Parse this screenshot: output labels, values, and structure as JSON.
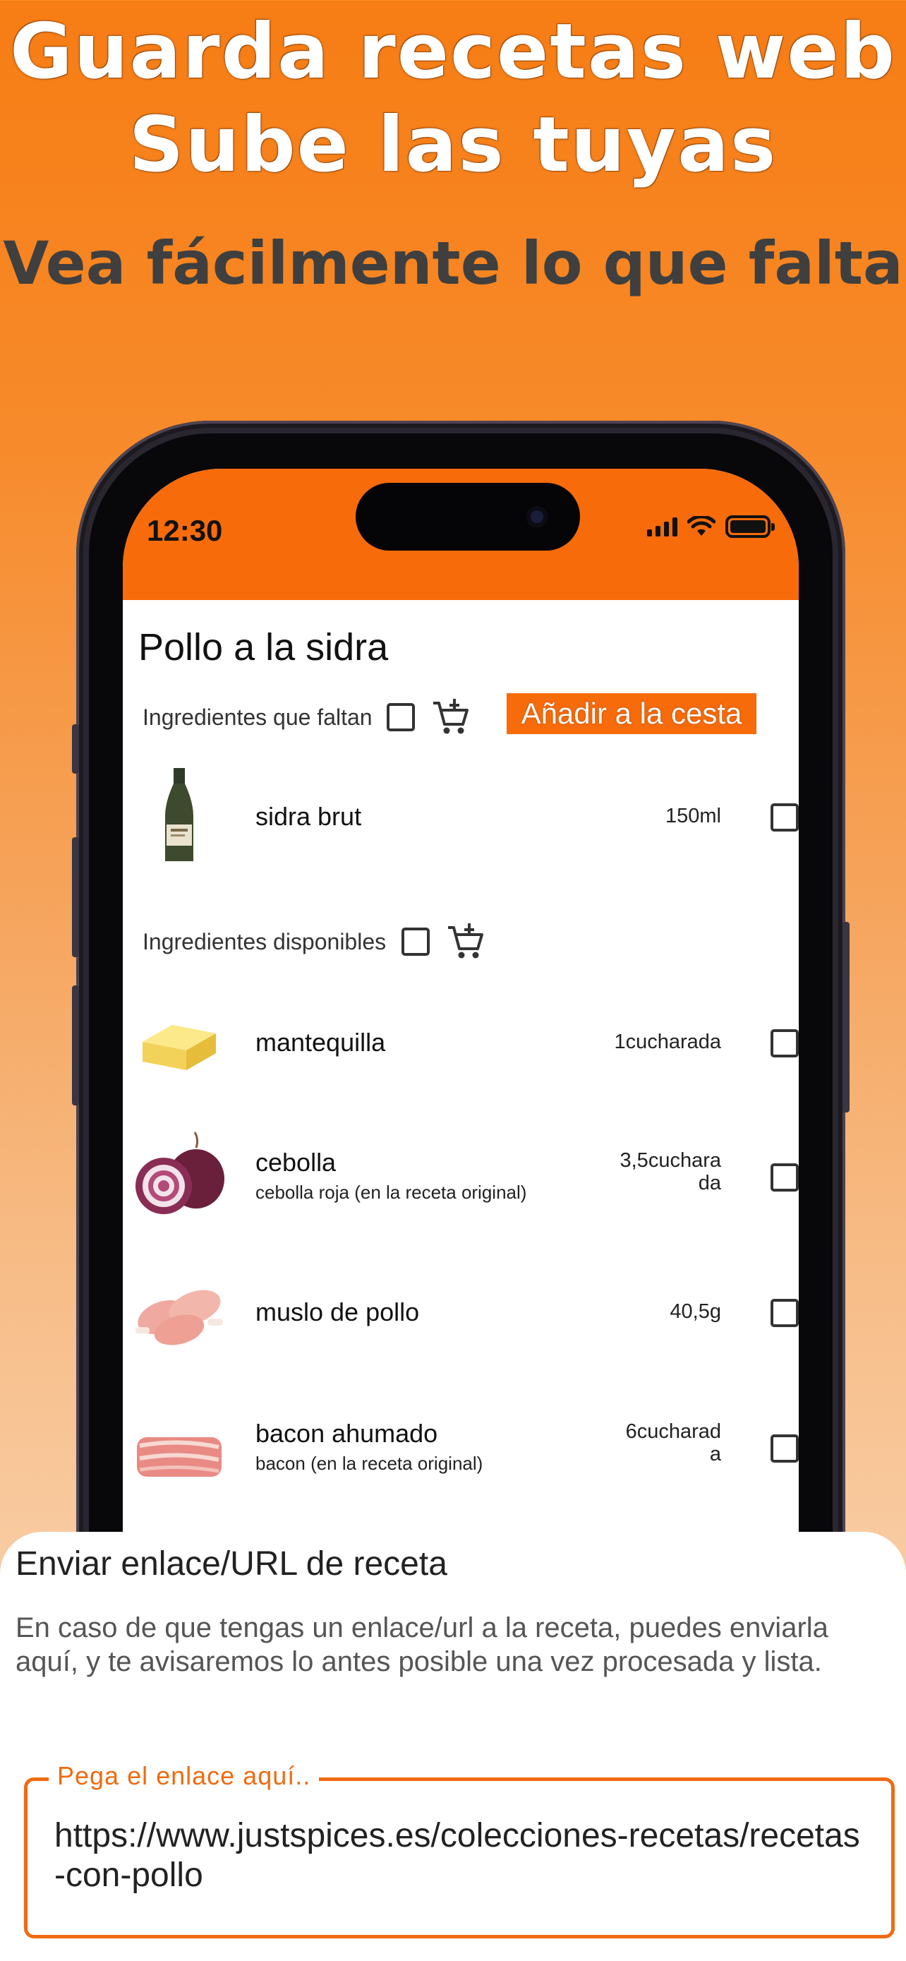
{
  "promo": {
    "line1": "Guarda recetas web",
    "line2": "Sube las tuyas",
    "line3": "Vea fácilmente lo que falta"
  },
  "status_bar": {
    "time": "12:30",
    "icons": [
      "signal-icon",
      "wifi-icon",
      "battery-icon"
    ],
    "color": "#f76b0b"
  },
  "recipe": {
    "title": "Pollo a la sidra",
    "missing_section": {
      "label": "Ingredientes que faltan",
      "add_button": "Añadir a la cesta"
    },
    "available_section": {
      "label": "Ingredientes disponibles"
    },
    "missing_items": [
      {
        "name": "sidra brut",
        "note": "",
        "qty": "150ml",
        "image": "cider-bottle",
        "checked": false
      }
    ],
    "available_items": [
      {
        "name": "mantequilla",
        "note": "",
        "qty": "1cucharada",
        "image": "butter",
        "checked": false
      },
      {
        "name": "cebolla",
        "note": "cebolla roja (en la receta original)",
        "qty_line1": "3,5cuchara",
        "qty_line2": "da",
        "image": "red-onion",
        "checked": false
      },
      {
        "name": "muslo de pollo",
        "note": "",
        "qty": "40,5g",
        "image": "chicken-thighs",
        "checked": false
      },
      {
        "name": "bacon ahumado",
        "note": "bacon (en la receta original)",
        "qty_line1": "6cucharad",
        "qty_line2": "a",
        "image": "bacon",
        "checked": false
      }
    ]
  },
  "sheet": {
    "title": "Enviar enlace/URL de receta",
    "description": "En caso de que tengas un enlace/url a la receta, puedes enviarla aquí, y te avisaremos lo antes posible una vez procesada y lista.",
    "input_label": "Pega el enlace aquí..",
    "input_value": "https://www.justspices.es/colecciones-recetas/recetas-con-pollo"
  },
  "colors": {
    "accent": "#f76b0b",
    "input_border": "#ef6b12"
  }
}
